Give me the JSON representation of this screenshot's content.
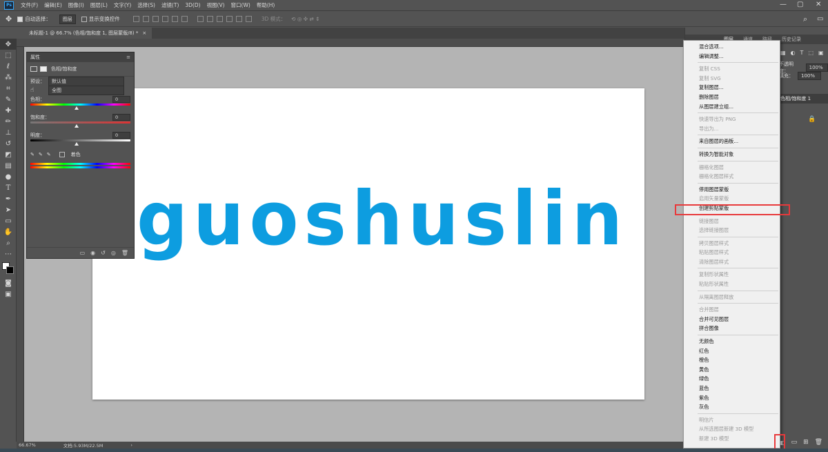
{
  "menubar": {
    "logo": "Ps",
    "items": [
      "文件(F)",
      "编辑(E)",
      "图像(I)",
      "图层(L)",
      "文字(Y)",
      "选择(S)",
      "滤镜(T)",
      "3D(D)",
      "视图(V)",
      "窗口(W)",
      "帮助(H)"
    ],
    "window_controls": [
      "—",
      "▢",
      "✕"
    ]
  },
  "options": {
    "auto_select_label": "自动选择：",
    "auto_select_value": "图层",
    "transform_label": "显示变换控件",
    "mode_3d": "3D 模式："
  },
  "document_tab": {
    "title": "未标题-1 @ 66.7% (色相/饱和度 1, 图层蒙版/8) *",
    "close": "×"
  },
  "canvas": {
    "text": "guoshuslin",
    "text_color": "#0d9de0"
  },
  "properties": {
    "header": "属性",
    "title": "色相/饱和度",
    "preset_label": "预设：",
    "preset_value": "默认值",
    "channel_value": "全图",
    "hue_label": "色相：",
    "hue_value": "0",
    "sat_label": "饱和度：",
    "sat_value": "0",
    "light_label": "明度：",
    "light_value": "0",
    "colorize_label": "着色"
  },
  "right_panel": {
    "tabs": [
      "图层",
      "通道",
      "路径",
      "历史记录"
    ],
    "opacity_label": "不透明度：",
    "opacity_value": "100%",
    "fill_label": "填充：",
    "fill_value": "100%",
    "layer_name": "色相/饱和度 1"
  },
  "context_menu": {
    "groups": [
      [
        {
          "label": "混合选项...",
          "enabled": true
        },
        {
          "label": "编辑调整...",
          "enabled": true
        }
      ],
      [
        {
          "label": "复制 CSS",
          "enabled": false
        },
        {
          "label": "复制 SVG",
          "enabled": false
        },
        {
          "label": "复制图层...",
          "enabled": true
        },
        {
          "label": "删除图层",
          "enabled": true
        },
        {
          "label": "从图层建立组...",
          "enabled": true
        }
      ],
      [
        {
          "label": "快速导出为 PNG",
          "enabled": false
        },
        {
          "label": "导出为...",
          "enabled": false
        }
      ],
      [
        {
          "label": "来自图层的画板...",
          "enabled": true
        }
      ],
      [
        {
          "label": "转换为智能对象",
          "enabled": true
        }
      ],
      [
        {
          "label": "栅格化图层",
          "enabled": false
        },
        {
          "label": "栅格化图层样式",
          "enabled": false
        }
      ],
      [
        {
          "label": "停用图层蒙版",
          "enabled": true
        },
        {
          "label": "启用矢量蒙版",
          "enabled": false
        },
        {
          "label": "创建剪贴蒙版",
          "enabled": true
        }
      ],
      [
        {
          "label": "链接图层",
          "enabled": false
        },
        {
          "label": "选择链接图层",
          "enabled": false
        }
      ],
      [
        {
          "label": "拷贝图层样式",
          "enabled": false
        },
        {
          "label": "粘贴图层样式",
          "enabled": false
        },
        {
          "label": "清除图层样式",
          "enabled": false
        }
      ],
      [
        {
          "label": "复制形状属性",
          "enabled": false
        },
        {
          "label": "粘贴形状属性",
          "enabled": false
        }
      ],
      [
        {
          "label": "从隔离图层释放",
          "enabled": false
        }
      ],
      [
        {
          "label": "合并图层",
          "enabled": false
        },
        {
          "label": "合并可见图层",
          "enabled": true
        },
        {
          "label": "拼合图像",
          "enabled": true
        }
      ],
      [
        {
          "label": "无颜色",
          "enabled": true
        },
        {
          "label": "红色",
          "enabled": true
        },
        {
          "label": "橙色",
          "enabled": true
        },
        {
          "label": "黄色",
          "enabled": true
        },
        {
          "label": "绿色",
          "enabled": true
        },
        {
          "label": "蓝色",
          "enabled": true
        },
        {
          "label": "紫色",
          "enabled": true
        },
        {
          "label": "灰色",
          "enabled": true
        }
      ],
      [
        {
          "label": "明信片",
          "enabled": false
        },
        {
          "label": "从所选图层新建 3D 模型",
          "enabled": false
        },
        {
          "label": "新建 3D 模型",
          "enabled": false
        }
      ]
    ]
  },
  "status": {
    "zoom": "66.67%",
    "doc": "文档:5.93M/22.5M",
    "arrow": "›"
  },
  "colors": {
    "highlight": "#e8393b",
    "panel_bg": "#535353",
    "workspace_bg": "#b4b4b4"
  }
}
